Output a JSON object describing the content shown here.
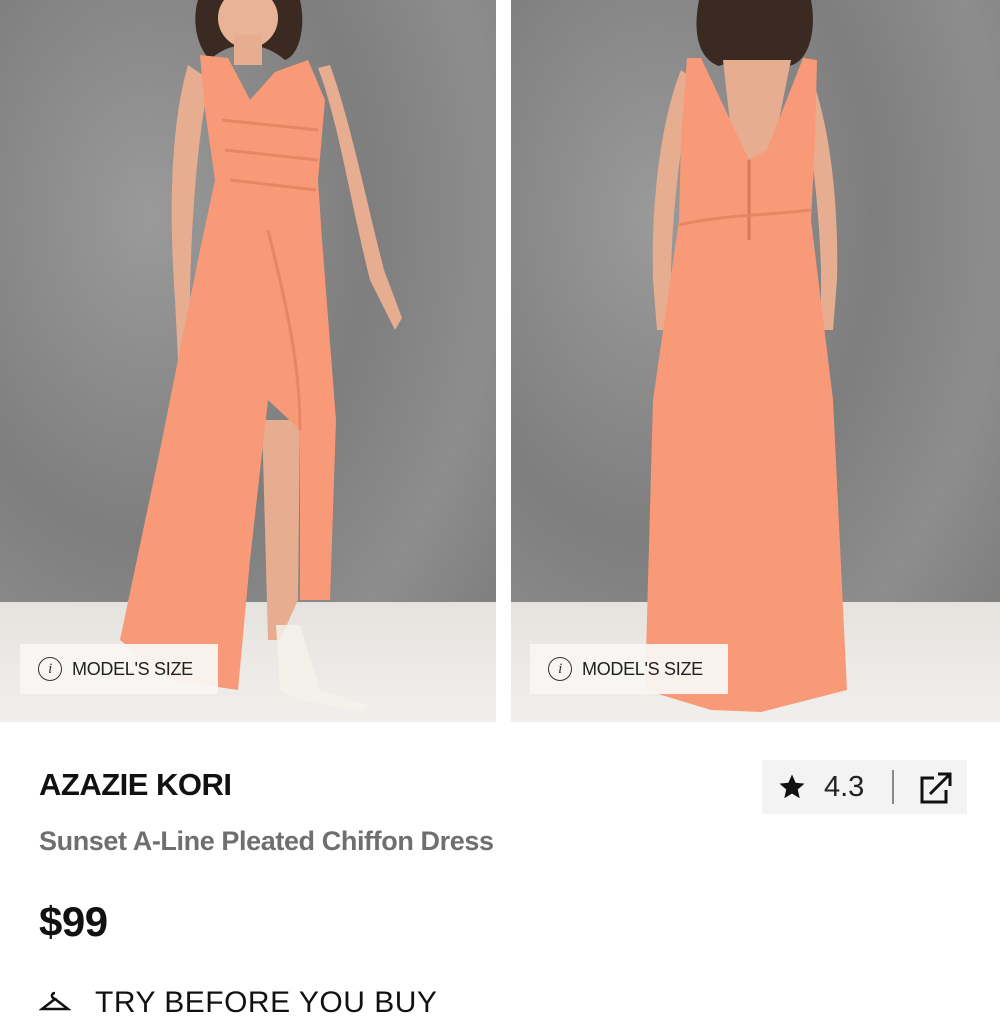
{
  "gallery": {
    "model_size_label_left": "MODEL'S SIZE",
    "model_size_label_right": "MODEL'S SIZE",
    "dress_color": "#F89A78",
    "info_icon_glyph": "i"
  },
  "product": {
    "brand": "AZAZIE KORI",
    "name": "Sunset A-Line Pleated Chiffon Dress",
    "price": "$99"
  },
  "rating": {
    "value": "4.3",
    "icons": [
      "star-icon",
      "share-icon"
    ]
  },
  "try_before_you_buy": {
    "label": "TRY BEFORE YOU BUY",
    "icon": "hanger-icon"
  }
}
